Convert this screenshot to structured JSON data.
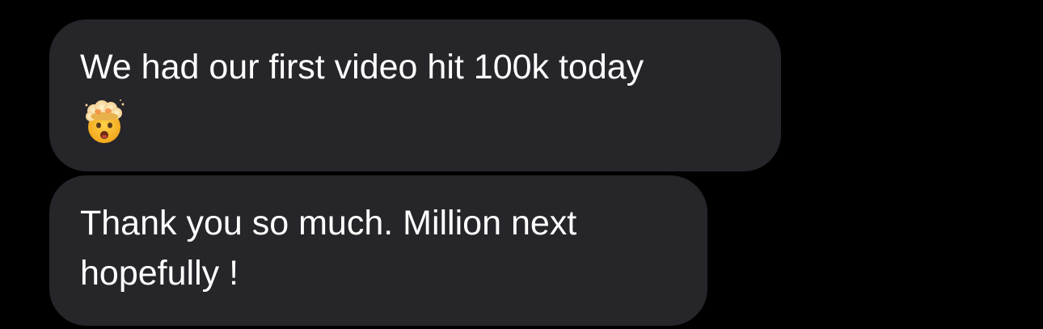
{
  "conversation": {
    "messages": [
      {
        "lines": [
          "We had our first video hit 100k today"
        ],
        "emoji": "exploding-head-icon"
      },
      {
        "lines": [
          "Thank you so much. Million next",
          "hopefully !"
        ]
      }
    ]
  },
  "colors": {
    "background": "#000000",
    "bubble": "#26252a",
    "text": "#ffffff"
  }
}
